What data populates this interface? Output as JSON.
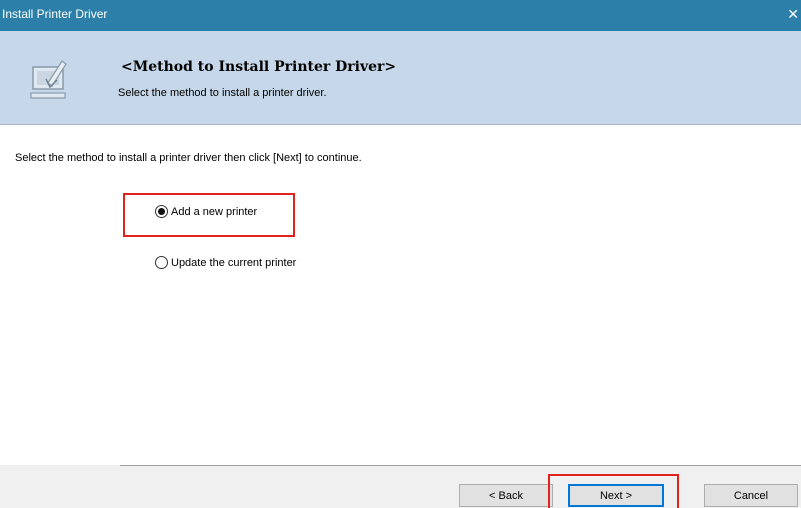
{
  "window": {
    "title": "Install Printer Driver",
    "close_glyph": "✕"
  },
  "header": {
    "title": "<Method to Install Printer Driver>",
    "subtitle": "Select the method to install a printer driver.",
    "icon": "install-computer-icon"
  },
  "main": {
    "instruction": "Select the method to install a printer driver then click [Next] to continue.",
    "options": [
      {
        "label": "Add a new printer",
        "checked": true,
        "highlighted": true
      },
      {
        "label": "Update the current printer",
        "checked": false,
        "highlighted": false
      }
    ]
  },
  "footer": {
    "back_label": "< Back",
    "next_label": "Next >",
    "cancel_label": "Cancel"
  },
  "colors": {
    "titlebar": "#2b7fa8",
    "header_bg": "#c5d7e8",
    "highlight": "#e1231b",
    "default_button_border": "#0078d7"
  }
}
